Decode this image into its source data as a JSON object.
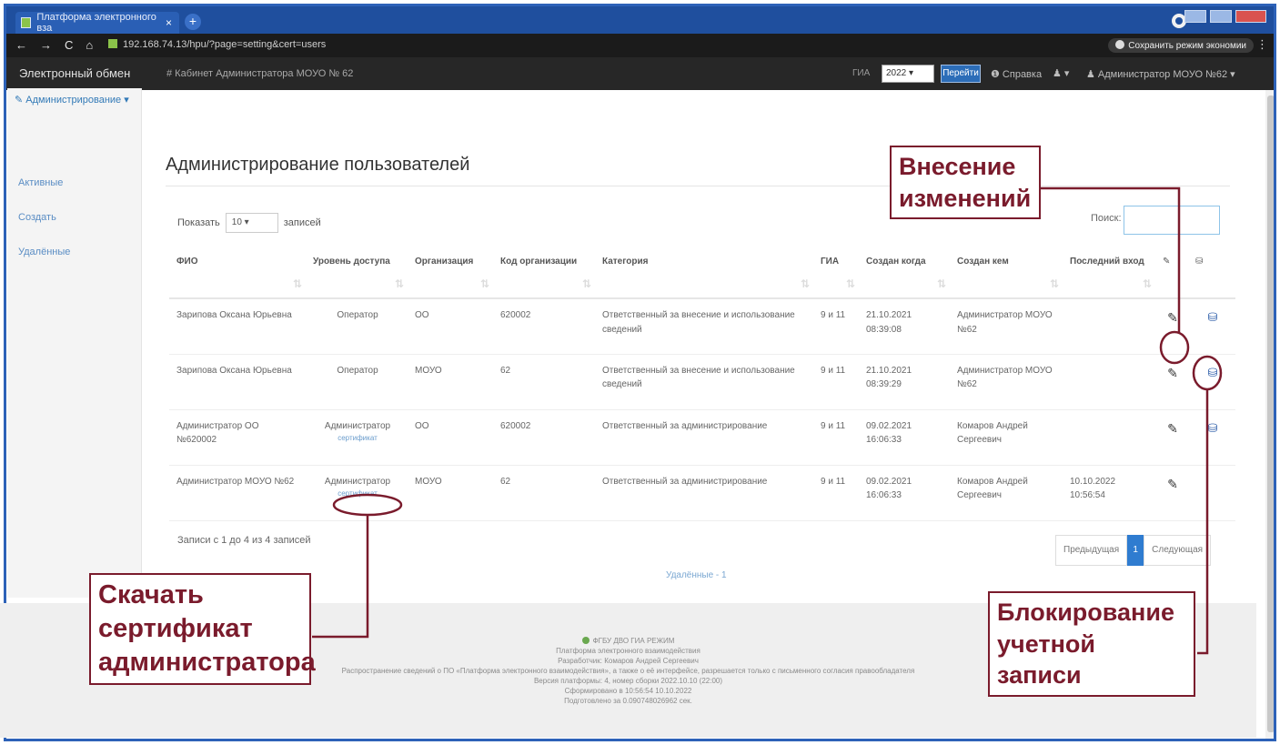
{
  "browser": {
    "tab_title": "Платформа электронного вза",
    "tab_close": "×",
    "new_tab": "+",
    "url": "192.168.74.13/hpu/?page=setting&cert=users",
    "save_button": "Сохранить режим экономии",
    "nav": [
      "←",
      "→",
      "C",
      "⌂"
    ]
  },
  "appnav": {
    "brand": "Электронный обмен",
    "cabinet": "# Кабинет Администратора МОУО № 62",
    "gia_label": "ГИА",
    "year": "2022",
    "go_button": "Перейти",
    "help": "Справка",
    "user_menu": "▾",
    "account": "Администратор МОУО №62"
  },
  "sidebar": {
    "header": "Администрирование ▾",
    "items": [
      "Активные",
      "Создать",
      "Удалённые"
    ]
  },
  "main": {
    "title": "Администрирование пользователей",
    "show_label": "Показать",
    "show_value": "10",
    "show_suffix": "записей",
    "search_label": "Поиск:",
    "search_value": "",
    "columns": [
      "ФИО",
      "Уровень доступа",
      "Организация",
      "Код организации",
      "Категория",
      "ГИА",
      "Создан когда",
      "Создан кем",
      "Последний вход",
      "✎",
      "⛁"
    ],
    "rows": [
      {
        "fio": "Зарипова Оксана Юрьевна",
        "level": "Оператор",
        "cert": "",
        "org": "ОО",
        "code": "620002",
        "category": "Ответственный за внесение и использование сведений",
        "gia": "9 и 11",
        "created": "21.10.2021 08:39:08",
        "created_by": "Администратор МОУО №62",
        "last": ""
      },
      {
        "fio": "Зарипова Оксана Юрьевна",
        "level": "Оператор",
        "cert": "",
        "org": "МОУО",
        "code": "62",
        "category": "Ответственный за внесение и использование сведений",
        "gia": "9 и 11",
        "created": "21.10.2021 08:39:29",
        "created_by": "Администратор МОУО №62",
        "last": ""
      },
      {
        "fio": "Администратор ОО №620002",
        "level": "Администратор",
        "cert": "сертификат",
        "org": "ОО",
        "code": "620002",
        "category": "Ответственный за администрирование",
        "gia": "9 и 11",
        "created": "09.02.2021 16:06:33",
        "created_by": "Комаров Андрей Сергеевич",
        "last": ""
      },
      {
        "fio": "Администратор МОУО №62",
        "level": "Администратор",
        "cert": "сертификат",
        "org": "МОУО",
        "code": "62",
        "category": "Ответственный за администрирование",
        "gia": "9 и 11",
        "created": "09.02.2021 16:06:33",
        "created_by": "Комаров Андрей Сергеевич",
        "last": "10.10.2022 10:56:54"
      }
    ],
    "records_info": "Записи с 1 до 4 из 4 записей",
    "pager": {
      "prev": "Предыдущая",
      "current": "1",
      "next": "Следующая"
    },
    "deleted_link": "Удалённые - 1"
  },
  "footer": {
    "lines": [
      "ФГБУ ДВО ГИА РЕЖИМ",
      "Платформа электронного взаимодействия",
      "Разработчик: Комаров Андрей Сергеевич",
      "Распространение сведений о ПО «Платформа электронного взаимодействия», а также о её интерфейсе, разрешается только с письменного согласия правообладателя",
      "Версия платформы: 4, номер сборки 2022.10.10 (22:00)",
      "Сформировано в 10:56:54 10.10.2022",
      "Подготовлено за 0.090748026962 сек."
    ]
  },
  "annotations": {
    "edit": "Внесение изменений",
    "cert": "Скачать сертификат администратора",
    "block": "Блокирование учетной записи"
  },
  "colors": {
    "frame": "#2d62b8",
    "callout": "#7a1b2c",
    "navbar": "#272727",
    "accent": "#2f7cd0"
  }
}
